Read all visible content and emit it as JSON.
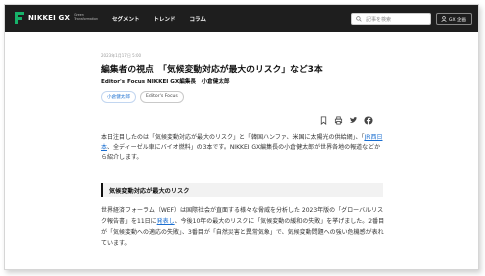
{
  "header": {
    "logo_text": "NIKKEI GX",
    "logo_sub": "Green Transformation",
    "nav": [
      "セグメント",
      "トレンド",
      "コラム"
    ],
    "search_placeholder": "記事を検索",
    "login_label": "GX 企画"
  },
  "article": {
    "date": "2023年1月17日 5:00",
    "headline": "編集者の視点　「気候変動対応が最大のリスク」など3本",
    "byline": "Editor's Focus NIKKEI GX編集長　小倉健太郎",
    "tags": [
      "小倉健太郎",
      "Editor's Focus"
    ],
    "share_icons": [
      "bookmark-icon",
      "print-icon",
      "twitter-icon",
      "facebook-icon"
    ],
    "intro_1": "本日注目したのは「気候変動対応が最大のリスク」と「韓国ハンファ、米国に太陽光の供給網」、「",
    "intro_link": "JR西日本",
    "intro_2": "、全ディーゼル車にバイオ燃料」の3本です。NIKKEI GX編集長の小倉健太郎が世界各地の報道などから紹介します。",
    "section_title": "気候変動対応が最大のリスク",
    "body_1": "世界経済フォーラム（WEF）は国際社会が直面する様々な脅威を分析した 2023年版の「グローバルリスク報告書」を11日に",
    "body_link": "発表し",
    "body_2": "、今後10年の最大のリスクに「気候変動の緩和の失敗」を挙げました。2番目が「気候変動への適応の失敗」、3番目が「自然災害と異常気象」で、気候変動問題への強い危機感が表れています。"
  }
}
